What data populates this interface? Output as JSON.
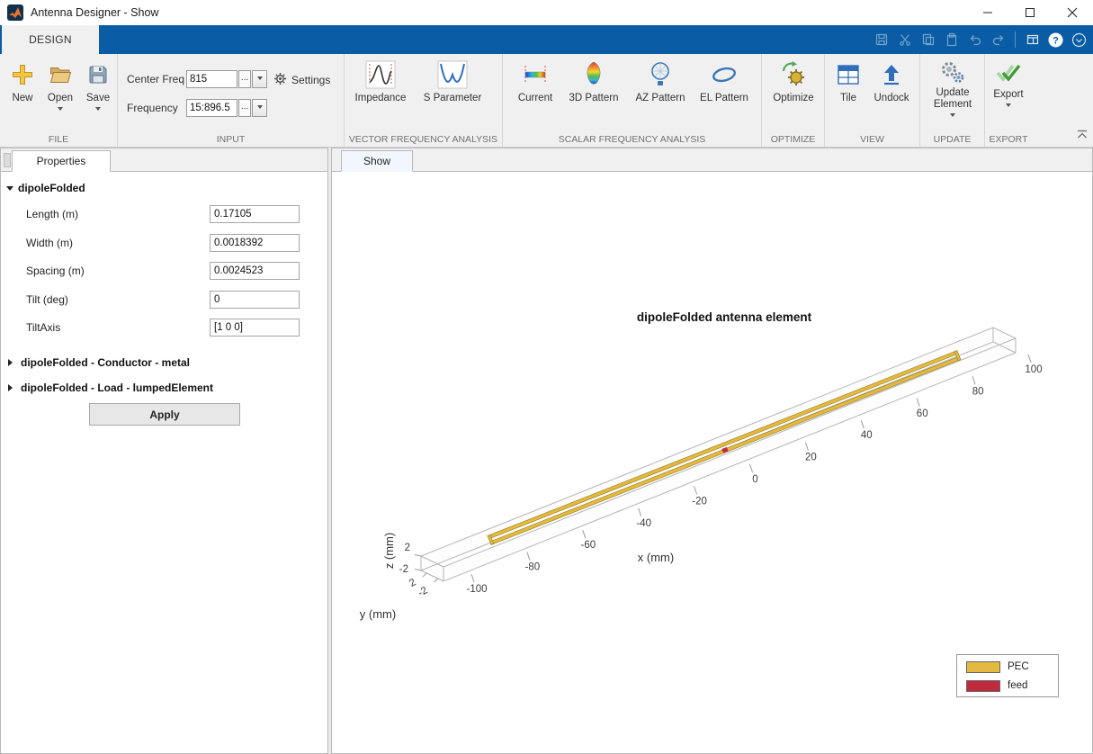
{
  "window": {
    "title": "Antenna Designer - Show"
  },
  "quick_access": {
    "icons": [
      "save",
      "cut",
      "copy",
      "paste",
      "undo",
      "redo",
      "layout",
      "help",
      "collapse"
    ],
    "help_glyph": "?"
  },
  "ribbon": {
    "design_tab": "DESIGN",
    "file": {
      "section": "FILE",
      "new": "New",
      "open": "Open",
      "save": "Save"
    },
    "input": {
      "section": "INPUT",
      "center_freq_label": "Center Freq",
      "center_freq_value": "815",
      "frequency_label": "Frequency",
      "frequency_value": "15:896.5",
      "more": "...",
      "settings": "Settings"
    },
    "vector": {
      "section": "VECTOR FREQUENCY ANALYSIS",
      "impedance": "Impedance",
      "sparameter": "S Parameter"
    },
    "scalar": {
      "section": "SCALAR FREQUENCY ANALYSIS",
      "current": "Current",
      "pattern3d": "3D Pattern",
      "az": "AZ Pattern",
      "el": "EL Pattern"
    },
    "optimize": {
      "section": "OPTIMIZE",
      "button": "Optimize"
    },
    "view": {
      "section": "VIEW",
      "tile": "Tile",
      "undock": "Undock"
    },
    "update": {
      "section": "UPDATE",
      "button": "Update Element"
    },
    "export": {
      "section": "EXPORT",
      "button": "Export"
    }
  },
  "properties": {
    "tab": "Properties",
    "group": "dipoleFolded",
    "fields": [
      {
        "label": "Length (m)",
        "value": "0.17105"
      },
      {
        "label": "Width (m)",
        "value": "0.0018392"
      },
      {
        "label": "Spacing (m)",
        "value": "0.0024523"
      },
      {
        "label": "Tilt (deg)",
        "value": "0"
      },
      {
        "label": "TiltAxis",
        "value": "[1 0 0]"
      }
    ],
    "conductor_group": "dipoleFolded - Conductor - metal",
    "load_group": "dipoleFolded - Load - lumpedElement",
    "apply": "Apply"
  },
  "plot": {
    "tab": "Show",
    "title": "dipoleFolded antenna element",
    "xlabel": "x (mm)",
    "ylabel": "y (mm)",
    "zlabel": "z (mm)",
    "legend": [
      {
        "label": "PEC",
        "color": "#e3ba3f"
      },
      {
        "label": "feed",
        "color": "#bf2b3d"
      }
    ]
  },
  "chart_data": {
    "type": "3d-geometry",
    "title": "dipoleFolded antenna element",
    "xlabel": "x (mm)",
    "ylabel": "y (mm)",
    "zlabel": "z (mm)",
    "x_ticks": [
      -100,
      -80,
      -60,
      -40,
      -20,
      0,
      20,
      40,
      60,
      80,
      100
    ],
    "y_ticks": [
      2,
      -2
    ],
    "z_ticks": [
      2,
      -2
    ],
    "objects": [
      {
        "name": "PEC",
        "color": "#e3ba3f",
        "shape": "folded dipole strip along x axis, length 0.17105 m, centered at origin"
      },
      {
        "name": "feed",
        "color": "#bf2b3d",
        "shape": "feed point at center of the folded dipole"
      }
    ],
    "legend_position": "bottom-right",
    "grid": false
  }
}
